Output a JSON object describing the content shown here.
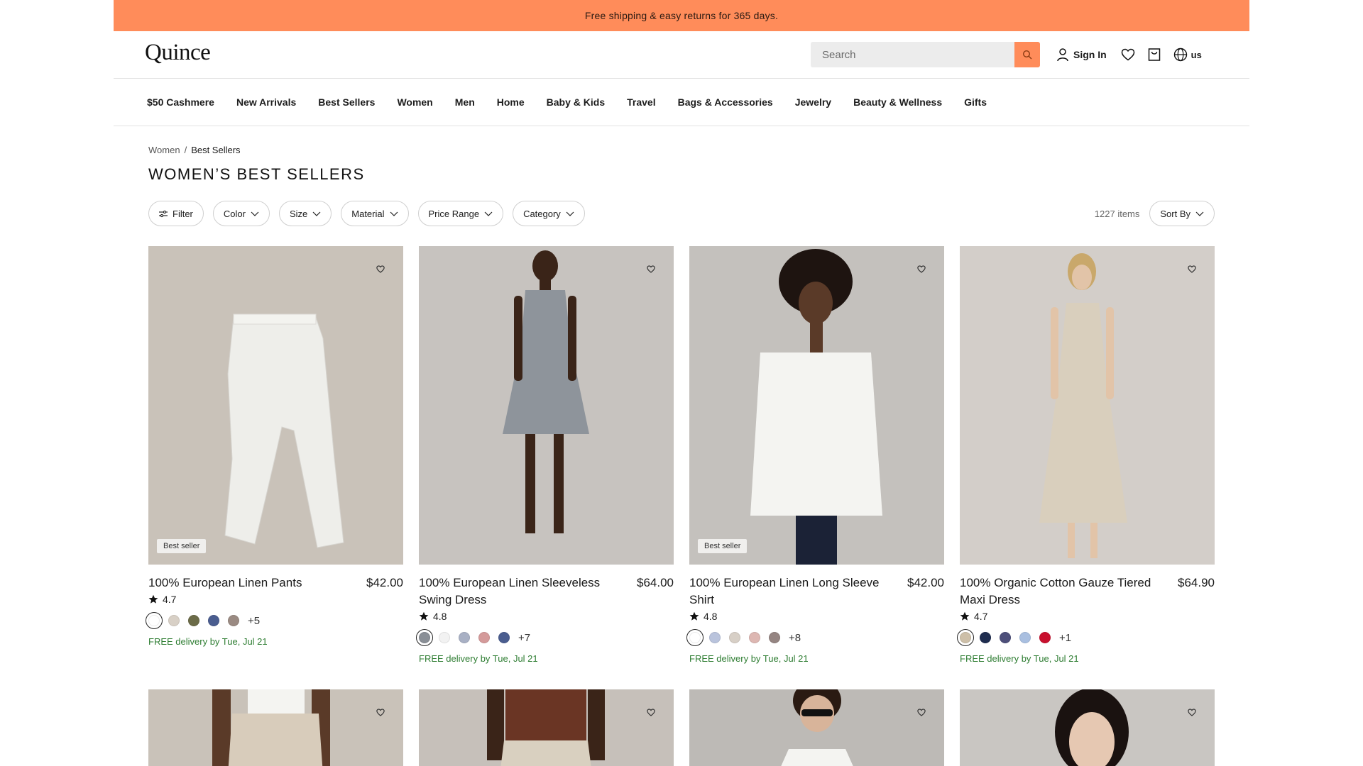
{
  "promo": {
    "text": "Free shipping & easy returns for 365 days."
  },
  "header": {
    "logo": "Quince",
    "search_placeholder": "Search",
    "sign_in": "Sign In",
    "locale": "us"
  },
  "nav": {
    "items": [
      {
        "label": "$50 Cashmere"
      },
      {
        "label": "New Arrivals"
      },
      {
        "label": "Best Sellers"
      },
      {
        "label": "Women"
      },
      {
        "label": "Men"
      },
      {
        "label": "Home"
      },
      {
        "label": "Baby & Kids"
      },
      {
        "label": "Travel"
      },
      {
        "label": "Bags & Accessories"
      },
      {
        "label": "Jewelry"
      },
      {
        "label": "Beauty & Wellness"
      },
      {
        "label": "Gifts"
      }
    ]
  },
  "breadcrumb": {
    "parent": "Women",
    "separator": "/",
    "current": "Best Sellers"
  },
  "page": {
    "title": "WOMEN’S BEST SELLERS"
  },
  "filters": {
    "filter": "Filter",
    "color": "Color",
    "size": "Size",
    "material": "Material",
    "price_range": "Price Range",
    "category": "Category",
    "items_count": "1227 items",
    "sort_by": "Sort By"
  },
  "colors": {
    "promo_bar": "#ff8c5a",
    "accent": "#ff8c5a",
    "delivery_green": "#2e7d32"
  },
  "products": [
    {
      "name": "100% European Linen Pants",
      "price": "$42.00",
      "rating": "4.7",
      "badge": "Best seller",
      "more_colors": "+5",
      "delivery": "FREE delivery by Tue, Jul 21",
      "image_bg": "#c9c2b9",
      "swatches": [
        "#ffffff",
        "#d8d0c6",
        "#6b6b48",
        "#4a5d8f",
        "#9a8a82"
      ]
    },
    {
      "name": "100% European Linen Sleeveless Swing Dress",
      "price": "$64.00",
      "rating": "4.8",
      "badge": "",
      "more_colors": "+7",
      "delivery": "FREE delivery by Tue, Jul 21",
      "image_bg": "#c7c3bf",
      "swatches": [
        "#8a8f96",
        "#f2f2f2",
        "#a8b0c4",
        "#d49a9a",
        "#4a5d8f"
      ]
    },
    {
      "name": "100% European Linen Long Sleeve Shirt",
      "price": "$42.00",
      "rating": "4.8",
      "badge": "Best seller",
      "more_colors": "+8",
      "delivery": "FREE delivery by Tue, Jul 21",
      "image_bg": "#c4c1bd",
      "swatches": [
        "#ffffff",
        "#b9c3dc",
        "#d7cfc6",
        "#ddb7b2",
        "#958582"
      ]
    },
    {
      "name": "100% Organic Cotton Gauze Tiered Maxi Dress",
      "price": "$64.90",
      "rating": "4.7",
      "badge": "",
      "more_colors": "+1",
      "delivery": "FREE delivery by Tue, Jul 21",
      "image_bg": "#d3cec9",
      "swatches": [
        "#cdbfa8",
        "#1f2d4f",
        "#4d4f7a",
        "#a9bfe0",
        "#c8102e"
      ]
    }
  ],
  "products_row2": [
    {
      "image_bg": "#c9c2b9"
    },
    {
      "image_bg": "#c6c0ba"
    },
    {
      "image_bg": "#bdbab6"
    },
    {
      "image_bg": "#c9c6c2"
    }
  ]
}
